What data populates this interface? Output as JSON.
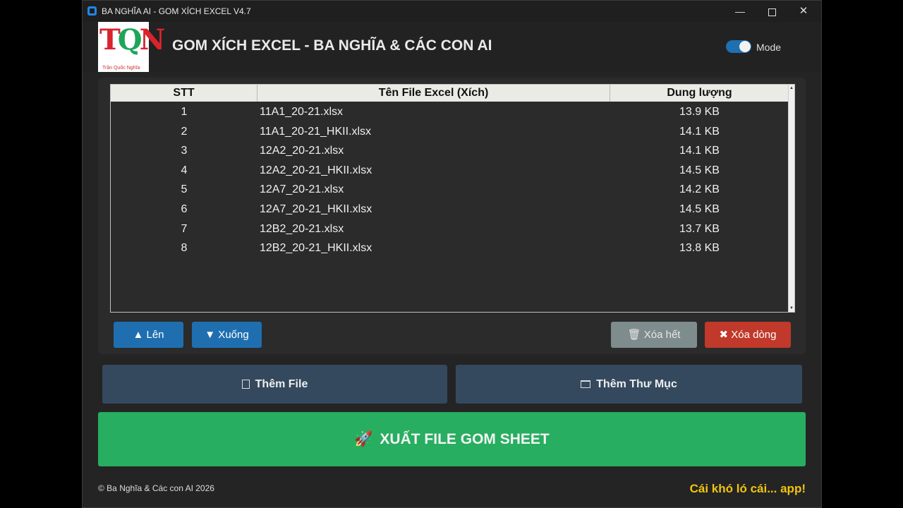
{
  "window": {
    "title": "BA NGHĨA AI - GOM XÍCH EXCEL V4.7",
    "minimize_glyph": "—",
    "close_glyph": "✕"
  },
  "header": {
    "app_title": "GOM XÍCH EXCEL - BA NGHĨA & CÁC CON AI",
    "mode_label": "Mode",
    "mode_on": true,
    "logo_text": "TQN",
    "logo_caption": "Trần Quốc Nghĩa"
  },
  "table": {
    "columns": [
      "STT",
      "Tên File Excel (Xích)",
      "Dung lượng"
    ],
    "rows": [
      [
        "1",
        "11A1_20-21.xlsx",
        "13.9 KB"
      ],
      [
        "2",
        "11A1_20-21_HKII.xlsx",
        "14.1 KB"
      ],
      [
        "3",
        "12A2_20-21.xlsx",
        "14.1 KB"
      ],
      [
        "4",
        "12A2_20-21_HKII.xlsx",
        "14.5 KB"
      ],
      [
        "5",
        "12A7_20-21.xlsx",
        "14.2 KB"
      ],
      [
        "6",
        "12A7_20-21_HKII.xlsx",
        "14.5 KB"
      ],
      [
        "7",
        "12B2_20-21.xlsx",
        "13.7 KB"
      ],
      [
        "8",
        "12B2_20-21_HKII.xlsx",
        "13.8 KB"
      ]
    ]
  },
  "actions": {
    "up": "▲ Lên",
    "down": "▼ Xuống",
    "clear_all": "🗑 Xóa hết",
    "delete_row": "✖ Xóa dòng",
    "add_file": "Thêm File",
    "add_folder": "Thêm Thư Mục",
    "export": "XUẤT FILE GOM SHEET",
    "export_icon": "🚀"
  },
  "footer": {
    "copyright": "© Ba Nghĩa & Các con AI 2026",
    "tagline": "Cái khó ló cái... app!"
  },
  "colors": {
    "accent_blue": "#1f6fb0",
    "danger": "#c0392b",
    "success": "#27ae60",
    "muted": "#7f8c8d",
    "tagline": "#f1c40f"
  }
}
